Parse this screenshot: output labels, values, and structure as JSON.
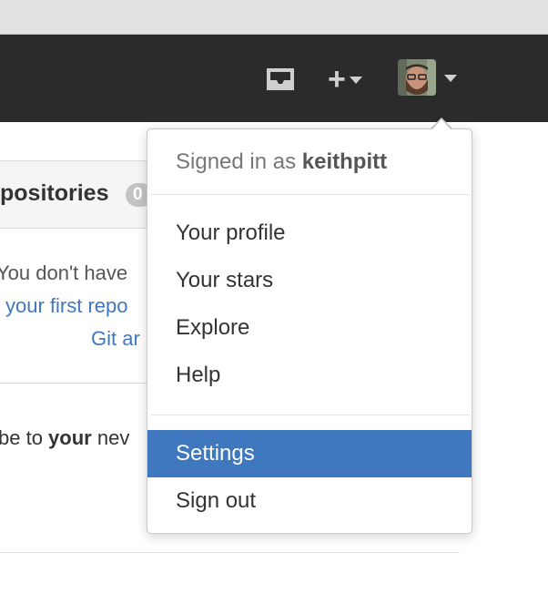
{
  "header": {
    "icons": [
      "inbox-icon",
      "plus-icon",
      "chevron-down-icon"
    ],
    "plus_label": "+",
    "colors": {
      "header_bg": "#2b2b2b",
      "accent": "#4078c0",
      "icon": "#cfcfcf"
    }
  },
  "background": {
    "repos_heading": "positories",
    "repos_count": "0",
    "empty_line1": "You don't have",
    "empty_link1": "your first repo",
    "empty_link2": "Git ar",
    "subscribe_prefix": "be to ",
    "subscribe_bold": "your",
    "subscribe_suffix": " nev"
  },
  "dropdown": {
    "signed_in_prefix": "Signed in as ",
    "username": "keithpitt",
    "items_group1": [
      {
        "label": "Your profile"
      },
      {
        "label": "Your stars"
      },
      {
        "label": "Explore"
      },
      {
        "label": "Help"
      }
    ],
    "items_group2": [
      {
        "label": "Settings",
        "active": true
      },
      {
        "label": "Sign out"
      }
    ]
  }
}
